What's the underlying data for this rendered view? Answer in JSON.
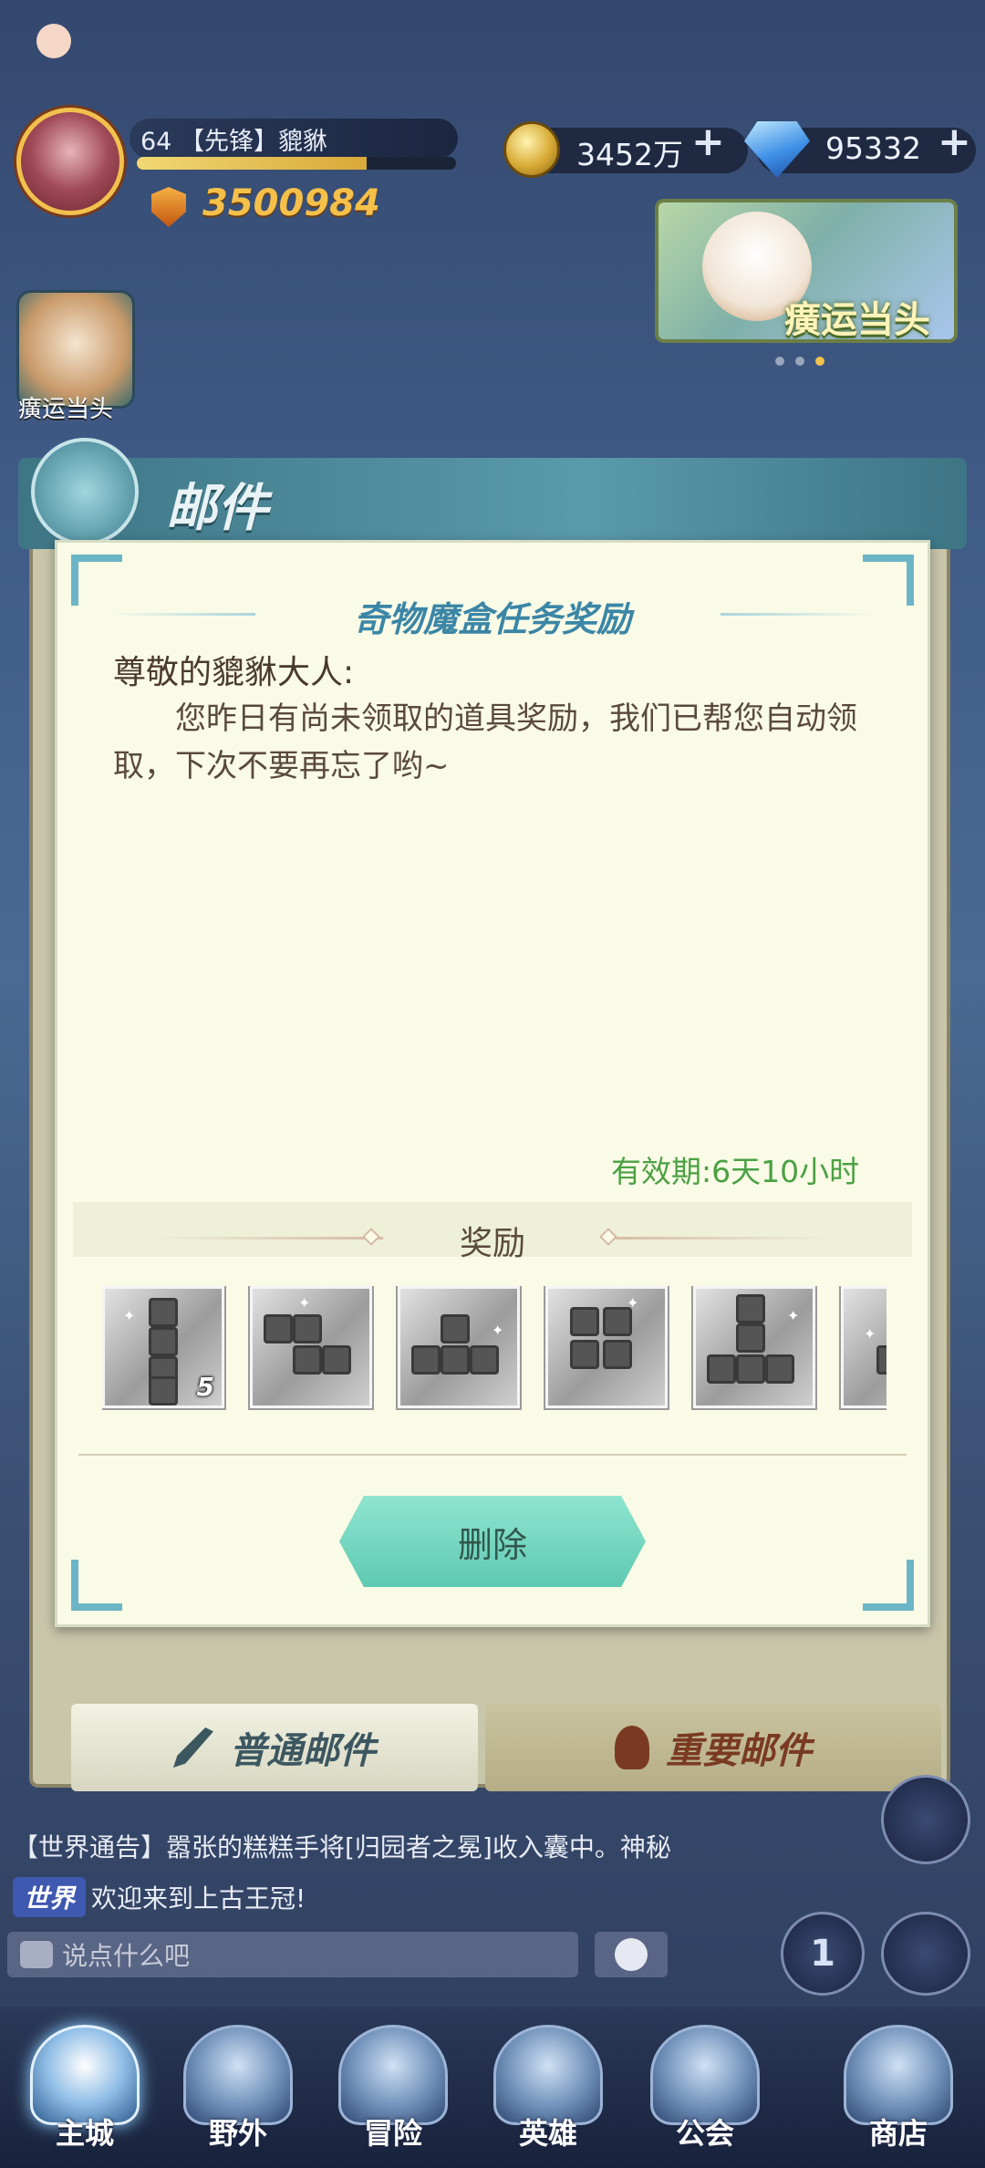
{
  "player": {
    "level_line": "64 【先锋】貔貅",
    "exp_fraction": 0.72,
    "power": "3500984"
  },
  "resources": {
    "coins": "3452万",
    "gems": "95332",
    "plus": "+"
  },
  "events": {
    "banner_label": "癀运当头",
    "left_label": "癀运当头"
  },
  "mail": {
    "panel_title": "邮件",
    "letter_title": "奇物魔盒任务奖励",
    "greeting": "尊敬的貔貅大人:",
    "body": "您昨日有尚未领取的道具奖励，我们已帮您自动领取，下次不要再忘了哟~",
    "validity": "有效期:6天10小时",
    "reward_title": "奖励",
    "items": [
      {
        "name": "block-piece-i",
        "count": "5"
      },
      {
        "name": "block-piece-z",
        "count": ""
      },
      {
        "name": "block-piece-t",
        "count": ""
      },
      {
        "name": "block-piece-square",
        "count": ""
      },
      {
        "name": "block-piece-l",
        "count": ""
      },
      {
        "name": "block-piece-partial",
        "count": ""
      }
    ],
    "delete_label": "删除"
  },
  "tabs": {
    "normal": "普通邮件",
    "important": "重要邮件"
  },
  "chat": {
    "row1": "【世界通告】嚣张的糕糕手将[归园者之冕]收入囊中。神秘",
    "world_tag": "世界",
    "row2": "欢迎来到上古王冠!",
    "input_placeholder": "说点什么吧",
    "rank_label": "1"
  },
  "nav": [
    {
      "label": "主城",
      "icon": "castle-icon"
    },
    {
      "label": "野外",
      "icon": "field-icon"
    },
    {
      "label": "冒险",
      "icon": "adventure-icon"
    },
    {
      "label": "英雄",
      "icon": "hero-icon"
    },
    {
      "label": "公会",
      "icon": "guild-icon"
    },
    {
      "label": "商店",
      "icon": "shop-icon"
    }
  ],
  "colors": {
    "accent_teal": "#6bb5c6",
    "validity_green": "#4ba144",
    "title_blue": "#3b86a6"
  }
}
